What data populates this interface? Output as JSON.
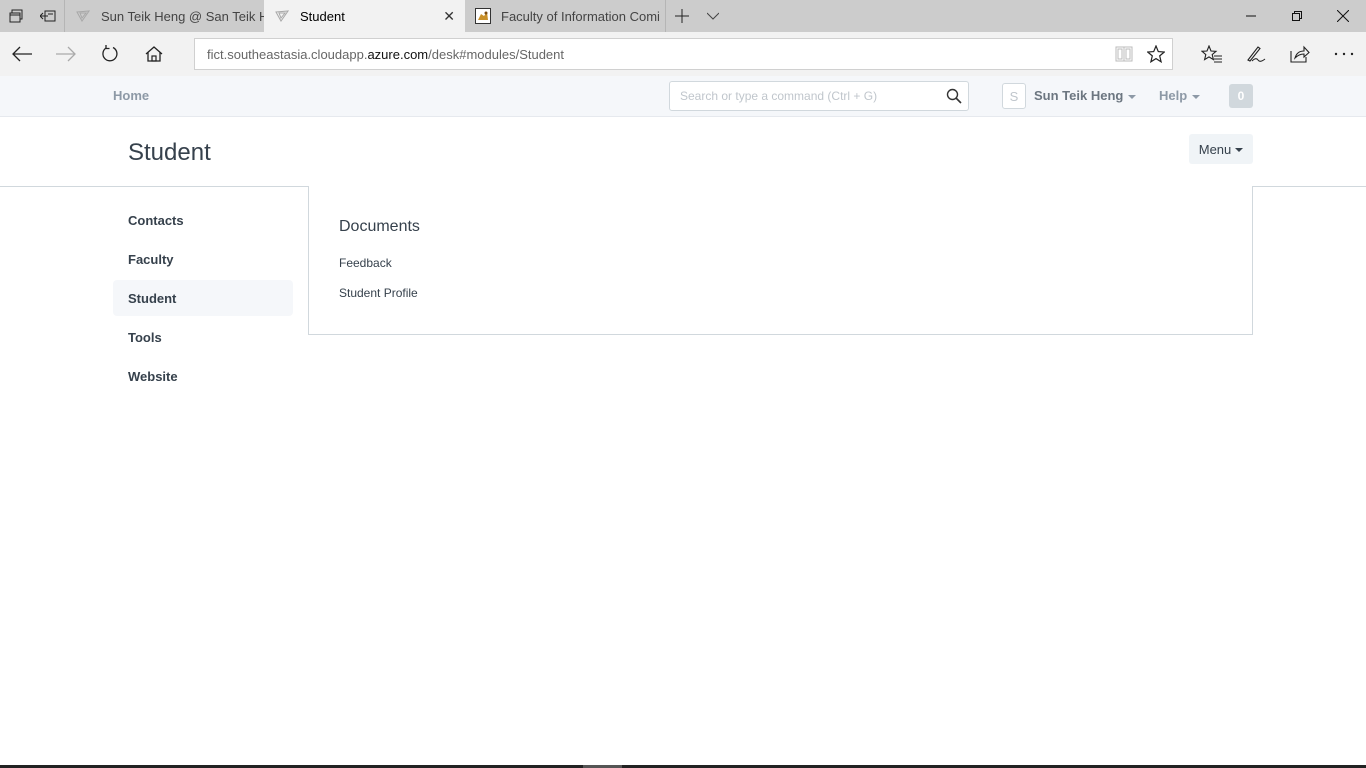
{
  "browser": {
    "tabs": [
      {
        "title": "Sun Teik Heng @ San Teik H",
        "icon": "frappe-logo-icon",
        "active": false
      },
      {
        "title": "Student",
        "icon": "frappe-logo-icon",
        "active": true
      },
      {
        "title": "Faculty of Information Comi",
        "icon": "site-favicon-icon",
        "active": false
      }
    ],
    "address": {
      "prefix": "fict.southeastasia.cloudapp.",
      "host": "azure.com",
      "path": "/desk#modules/Student"
    }
  },
  "app": {
    "nav": {
      "home_label": "Home",
      "search_placeholder": "Search or type a command (Ctrl + G)",
      "avatar_letter": "S",
      "user_name": "Sun Teik Heng",
      "help_label": "Help",
      "notification_count": "0"
    },
    "page": {
      "title": "Student",
      "menu_label": "Menu"
    },
    "sidebar": {
      "items": [
        {
          "label": "Contacts",
          "selected": false
        },
        {
          "label": "Faculty",
          "selected": false
        },
        {
          "label": "Student",
          "selected": true
        },
        {
          "label": "Tools",
          "selected": false
        },
        {
          "label": "Website",
          "selected": false
        }
      ]
    },
    "section": {
      "heading": "Documents",
      "links": [
        "Feedback",
        "Student Profile"
      ]
    }
  }
}
